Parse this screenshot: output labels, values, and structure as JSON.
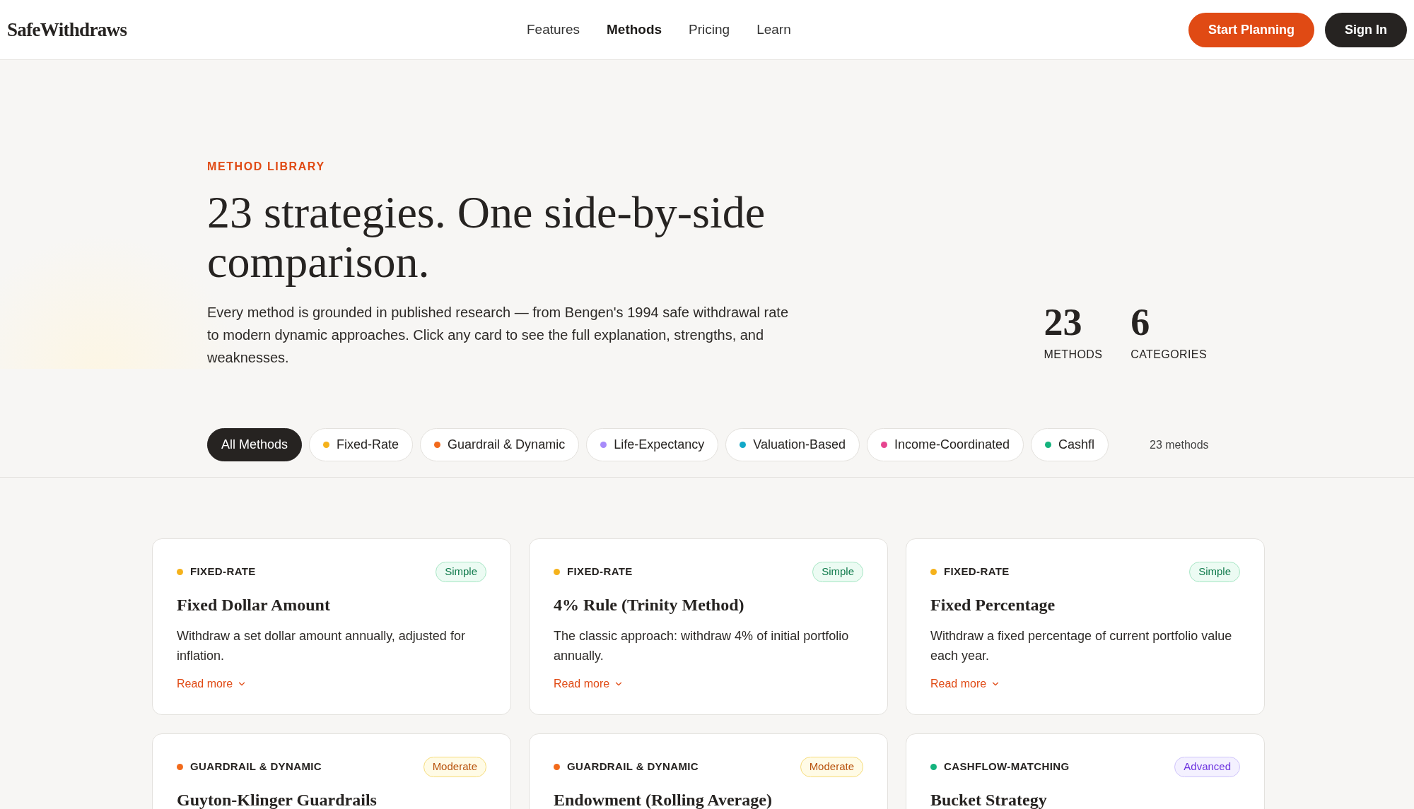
{
  "header": {
    "logo": "SafeWithdraws",
    "nav": [
      {
        "label": "Features",
        "selected": false
      },
      {
        "label": "Methods",
        "selected": true
      },
      {
        "label": "Pricing",
        "selected": false
      },
      {
        "label": "Learn",
        "selected": false
      }
    ],
    "buttons": [
      {
        "label": "Start Planning",
        "kind": "primary"
      },
      {
        "label": "Sign In",
        "kind": "dark"
      }
    ]
  },
  "hero": {
    "eyebrow": "METHOD LIBRARY",
    "title": "23 strategies. One side-by-side comparison.",
    "description": "Every method is grounded in published research — from Bengen's 1994 safe withdrawal rate to modern dynamic approaches. Click any card to see the full explanation, strengths, and weaknesses.",
    "stats": [
      {
        "value": "23",
        "label": "METHODS"
      },
      {
        "value": "6",
        "label": "CATEGORIES"
      }
    ]
  },
  "filters": {
    "chips": [
      {
        "label": "All Methods",
        "selected": true
      },
      {
        "label": "Fixed-Rate",
        "selected": false,
        "color": "#f5b21b"
      },
      {
        "label": "Guardrail & Dynamic",
        "selected": false,
        "color": "#f26a1b"
      },
      {
        "label": "Life-Expectancy",
        "selected": false,
        "color": "#a78bfa"
      },
      {
        "label": "Valuation-Based",
        "selected": false,
        "color": "#12a8c8"
      },
      {
        "label": "Income-Coordinated",
        "selected": false,
        "color": "#e6458f"
      },
      {
        "label": "Cashfl",
        "selected": false,
        "color": "#14b37d"
      }
    ],
    "count": "23 methods"
  },
  "cards": [
    {
      "category": "FIXED-RATE",
      "color": "#f5b21b",
      "difficulty": "Simple",
      "kind": "simple",
      "title": "Fixed Dollar Amount",
      "description": "Withdraw a set dollar amount annually, adjusted for inflation.",
      "link": "Read more"
    },
    {
      "category": "FIXED-RATE",
      "color": "#f5b21b",
      "difficulty": "Simple",
      "kind": "simple",
      "title": "4% Rule (Trinity Method)",
      "description": "The classic approach: withdraw 4% of initial portfolio annually.",
      "link": "Read more"
    },
    {
      "category": "FIXED-RATE",
      "color": "#f5b21b",
      "difficulty": "Simple",
      "kind": "simple",
      "title": "Fixed Percentage",
      "description": "Withdraw a fixed percentage of current portfolio value each year.",
      "link": "Read more"
    },
    {
      "category": "GUARDRAIL & DYNAMIC",
      "color": "#f26a1b",
      "difficulty": "Moderate",
      "kind": "moderate",
      "title": "Guyton-Klinger Guardrails"
    },
    {
      "category": "GUARDRAIL & DYNAMIC",
      "color": "#f26a1b",
      "difficulty": "Moderate",
      "kind": "moderate",
      "title": "Endowment (Rolling Average)"
    },
    {
      "category": "CASHFLOW-MATCHING",
      "color": "#14b37d",
      "difficulty": "Advanced",
      "kind": "advanced",
      "title": "Bucket Strategy"
    }
  ]
}
